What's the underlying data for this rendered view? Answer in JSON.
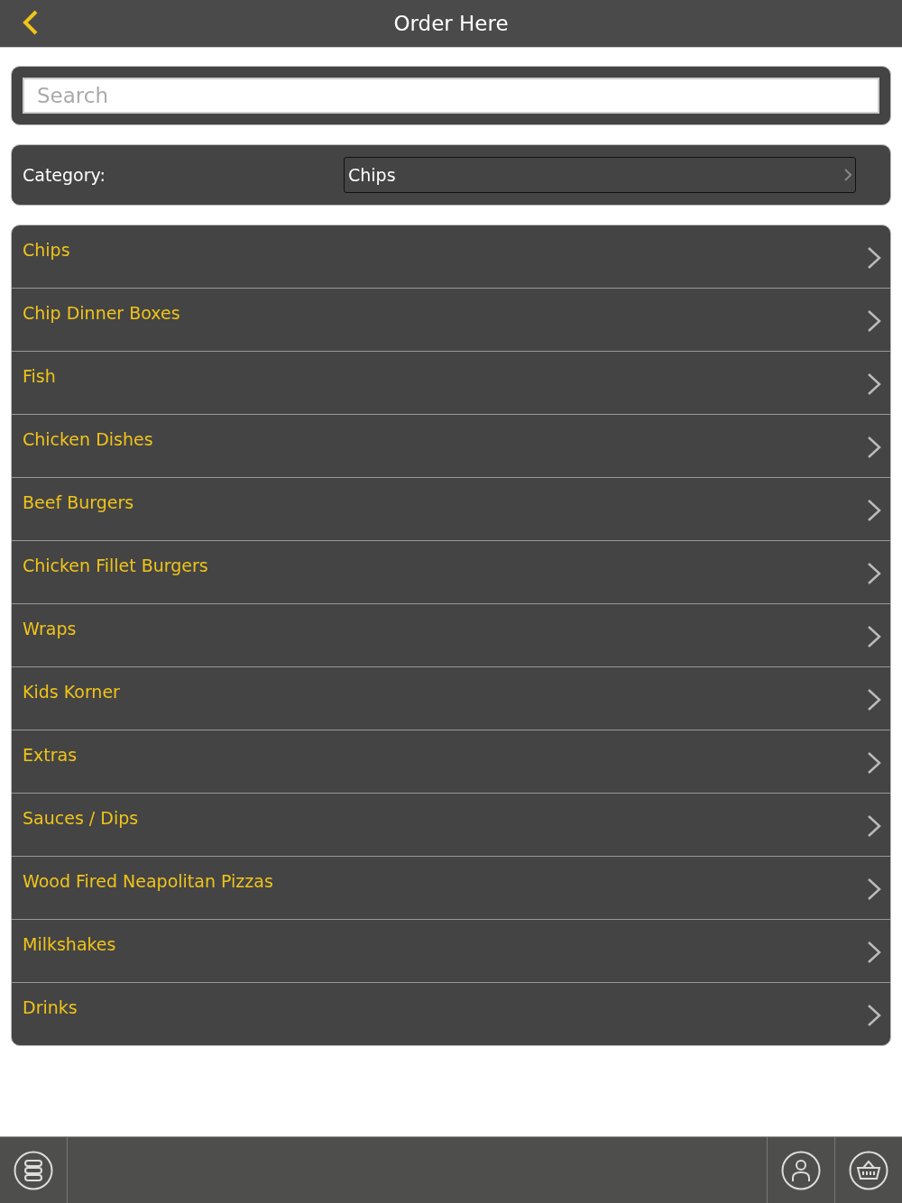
{
  "header": {
    "title": "Order Here"
  },
  "search": {
    "placeholder": "Search"
  },
  "category": {
    "label": "Category:",
    "value": "Chips"
  },
  "items": [
    {
      "label": "Chips"
    },
    {
      "label": "Chip Dinner Boxes"
    },
    {
      "label": "Fish"
    },
    {
      "label": "Chicken Dishes"
    },
    {
      "label": "Beef Burgers"
    },
    {
      "label": "Chicken Fillet Burgers"
    },
    {
      "label": "Wraps"
    },
    {
      "label": "Kids Korner"
    },
    {
      "label": "Extras"
    },
    {
      "label": "Sauces / Dips"
    },
    {
      "label": "Wood Fired Neapolitan Pizzas"
    },
    {
      "label": "Milkshakes"
    },
    {
      "label": "Drinks"
    }
  ]
}
